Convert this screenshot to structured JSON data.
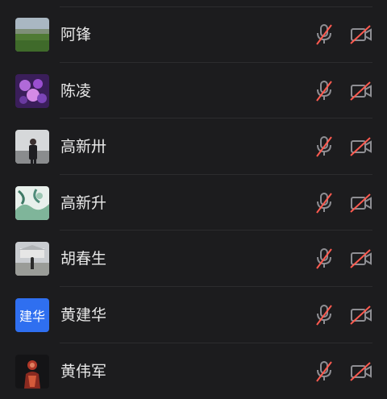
{
  "participants": [
    {
      "name": "阿锋",
      "avatar": "meadow-photo",
      "mic_muted": true,
      "camera_off": true
    },
    {
      "name": "陈凌",
      "avatar": "purple-flower-photo",
      "mic_muted": true,
      "camera_off": true
    },
    {
      "name": "高新卅",
      "avatar": "person-photo",
      "mic_muted": true,
      "camera_off": true
    },
    {
      "name": "高新升",
      "avatar": "painting-photo",
      "mic_muted": true,
      "camera_off": true
    },
    {
      "name": "胡春生",
      "avatar": "building-photo",
      "mic_muted": true,
      "camera_off": true
    },
    {
      "name": "黄建华",
      "avatar_text": "建华",
      "avatar": "initials-avatar",
      "mic_muted": true,
      "camera_off": true
    },
    {
      "name": "黄伟军",
      "avatar": "person-dark-photo",
      "mic_muted": true,
      "camera_off": true
    }
  ],
  "colors": {
    "background": "#1c1c1e",
    "divider": "#2c2c2e",
    "name_text": "#e8e8e8",
    "icon_gray": "#8e8e93",
    "mute_slash": "#ff5a4f",
    "avatar_blue": "#2f6ff0"
  }
}
